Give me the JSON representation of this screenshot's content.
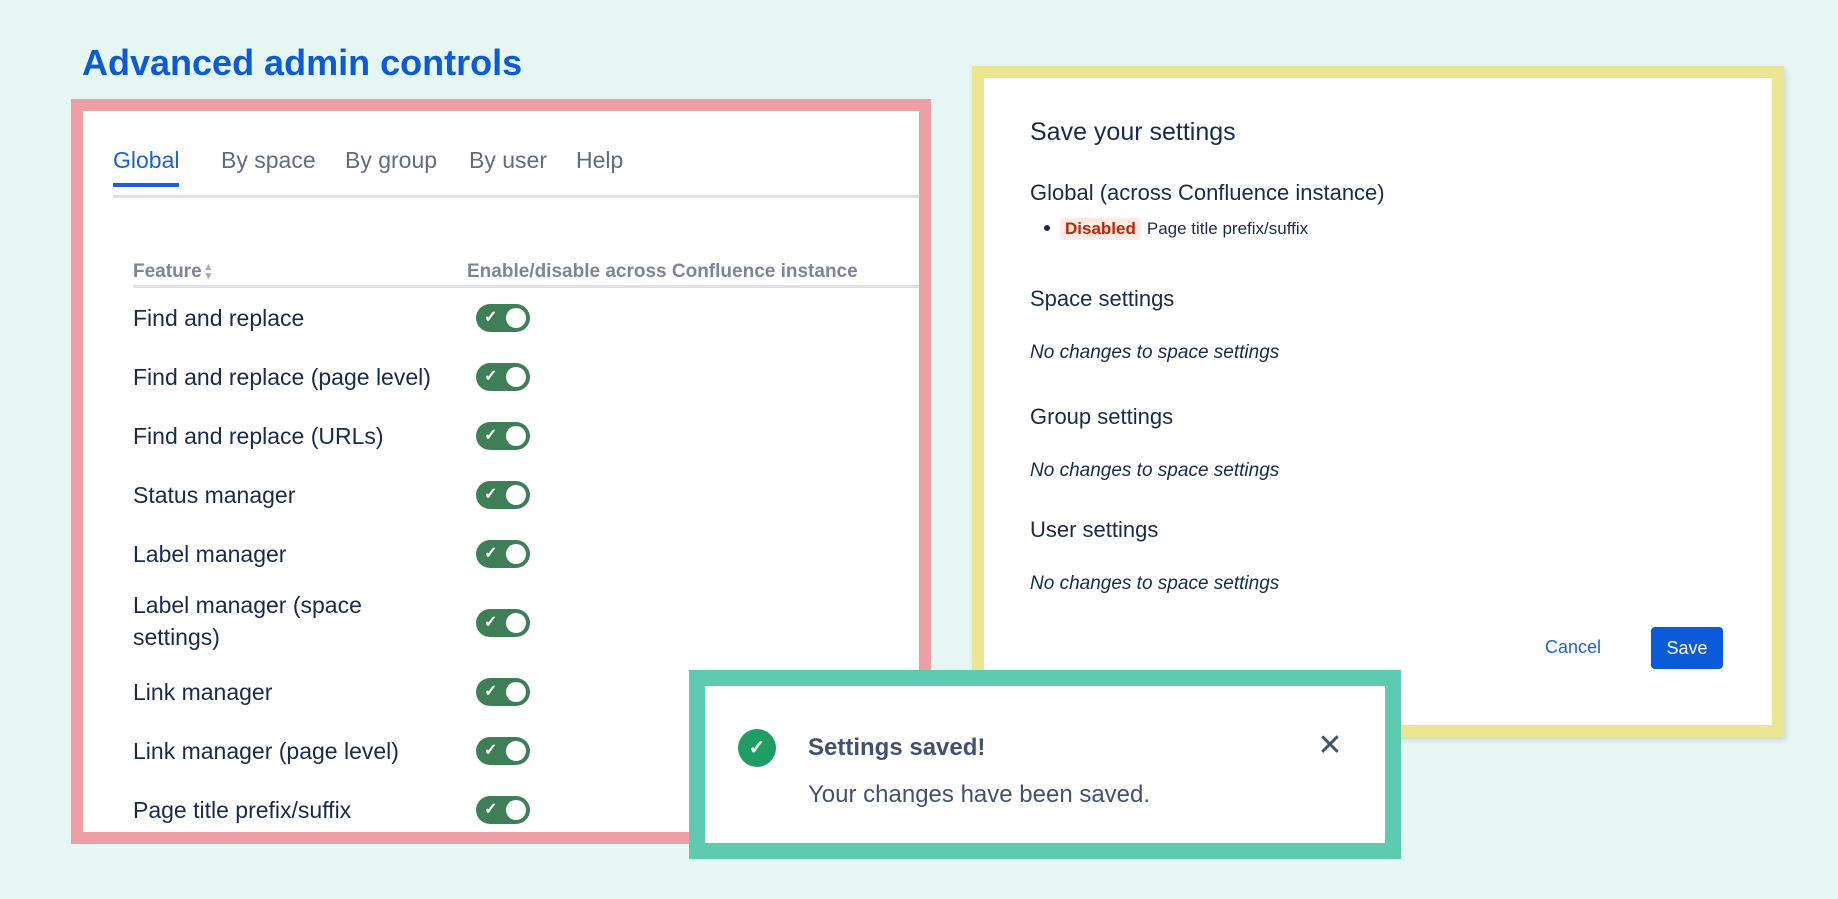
{
  "page_title": "Advanced admin controls",
  "tabs": [
    {
      "label": "Global",
      "active": true
    },
    {
      "label": "By space",
      "active": false
    },
    {
      "label": "By group",
      "active": false
    },
    {
      "label": "By user",
      "active": false
    },
    {
      "label": "Help",
      "active": false
    }
  ],
  "table": {
    "col_feature": "Feature",
    "col_enable": "Enable/disable across Confluence instance",
    "rows": [
      {
        "feature": "Find and replace",
        "enabled": true
      },
      {
        "feature": "Find and replace (page level)",
        "enabled": true
      },
      {
        "feature": "Find and replace (URLs)",
        "enabled": true
      },
      {
        "feature": "Status manager",
        "enabled": true
      },
      {
        "feature": "Label manager",
        "enabled": true
      },
      {
        "feature": "Label manager (space settings)",
        "enabled": true
      },
      {
        "feature": "Link manager",
        "enabled": true
      },
      {
        "feature": "Link manager (page level)",
        "enabled": true
      },
      {
        "feature": "Page title prefix/suffix",
        "enabled": true
      }
    ]
  },
  "save_dialog": {
    "title": "Save your settings",
    "global_heading": "Global (across Confluence instance)",
    "global_item": {
      "status": "Disabled",
      "feature": "Page title prefix/suffix"
    },
    "space_heading": "Space settings",
    "space_note": "No changes to space settings",
    "group_heading": "Group settings",
    "group_note": "No changes to space settings",
    "user_heading": "User settings",
    "user_note": "No changes to space settings",
    "cancel_label": "Cancel",
    "save_label": "Save"
  },
  "toast": {
    "title": "Settings saved!",
    "message": "Your changes have been saved."
  },
  "colors": {
    "accent": "#0b5ad8",
    "toggle_on": "#3f7f57",
    "left_frame": "#ee9fa3",
    "right_frame": "#ece693",
    "toast_frame": "#5ccbb0",
    "success": "#1f9d62",
    "disabled_text": "#bf2600"
  }
}
